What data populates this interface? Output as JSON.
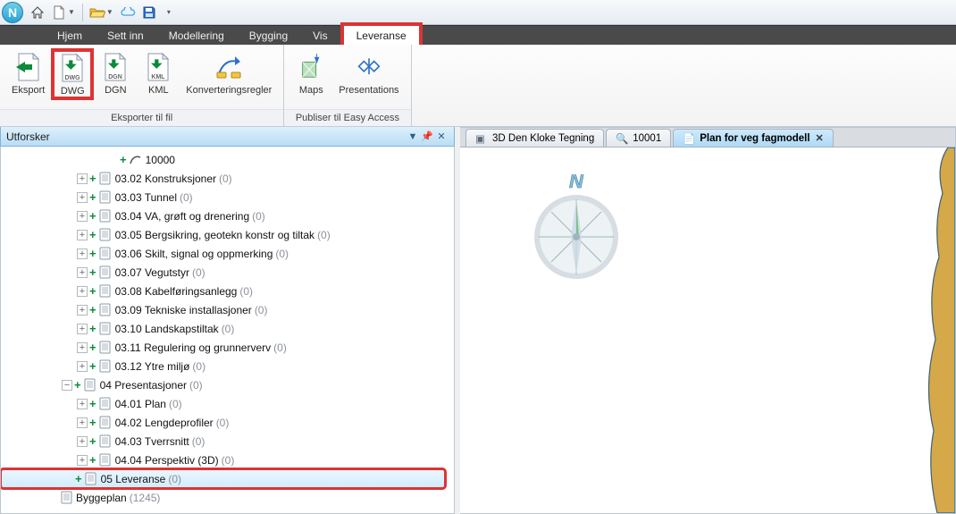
{
  "qat": {
    "app_letter": "N"
  },
  "ribbon_tabs": {
    "hjem": "Hjem",
    "settinn": "Sett inn",
    "modellering": "Modellering",
    "bygging": "Bygging",
    "vis": "Vis",
    "leveranse": "Leveranse"
  },
  "ribbon": {
    "group1_label": "Eksporter til fil",
    "group2_label": "Publiser til Easy Access",
    "btn_eksport": "Eksport",
    "btn_dwg": "DWG",
    "btn_dgn": "DGN",
    "btn_kml": "KML",
    "btn_konv": "Konverteringsregler",
    "btn_maps": "Maps",
    "btn_presentations": "Presentations"
  },
  "explorer": {
    "title": "Utforsker"
  },
  "tree": [
    {
      "indent": 7,
      "expand": "none",
      "plus": true,
      "icon": "curve",
      "label": "10000",
      "count": null
    },
    {
      "indent": 5,
      "expand": "plus",
      "plus": true,
      "icon": "doc",
      "label": "03.02 Konstruksjoner",
      "count": 0
    },
    {
      "indent": 5,
      "expand": "plus",
      "plus": true,
      "icon": "doc",
      "label": "03.03 Tunnel",
      "count": 0
    },
    {
      "indent": 5,
      "expand": "plus",
      "plus": true,
      "icon": "doc",
      "label": "03.04 VA, grøft og drenering",
      "count": 0
    },
    {
      "indent": 5,
      "expand": "plus",
      "plus": true,
      "icon": "doc",
      "label": "03.05 Bergsikring, geotekn konstr og tiltak",
      "count": 0
    },
    {
      "indent": 5,
      "expand": "plus",
      "plus": true,
      "icon": "doc",
      "label": "03.06 Skilt, signal og oppmerking",
      "count": 0
    },
    {
      "indent": 5,
      "expand": "plus",
      "plus": true,
      "icon": "doc",
      "label": "03.07 Vegutstyr",
      "count": 0
    },
    {
      "indent": 5,
      "expand": "plus",
      "plus": true,
      "icon": "doc",
      "label": "03.08 Kabelføringsanlegg",
      "count": 0
    },
    {
      "indent": 5,
      "expand": "plus",
      "plus": true,
      "icon": "doc",
      "label": "03.09 Tekniske installasjoner",
      "count": 0
    },
    {
      "indent": 5,
      "expand": "plus",
      "plus": true,
      "icon": "doc",
      "label": "03.10 Landskapstiltak",
      "count": 0
    },
    {
      "indent": 5,
      "expand": "plus",
      "plus": true,
      "icon": "doc",
      "label": "03.11 Regulering og grunnerverv",
      "count": 0
    },
    {
      "indent": 5,
      "expand": "plus",
      "plus": true,
      "icon": "doc",
      "label": "03.12 Ytre miljø",
      "count": 0
    },
    {
      "indent": 4,
      "expand": "minus",
      "plus": true,
      "icon": "doc",
      "label": "04 Presentasjoner",
      "count": 0
    },
    {
      "indent": 5,
      "expand": "plus",
      "plus": true,
      "icon": "doc",
      "label": "04.01 Plan",
      "count": 0
    },
    {
      "indent": 5,
      "expand": "plus",
      "plus": true,
      "icon": "doc",
      "label": "04.02 Lengdeprofiler",
      "count": 0
    },
    {
      "indent": 5,
      "expand": "plus",
      "plus": true,
      "icon": "doc",
      "label": "04.03 Tverrsnitt",
      "count": 0
    },
    {
      "indent": 5,
      "expand": "plus",
      "plus": true,
      "icon": "doc",
      "label": "04.04 Perspektiv (3D)",
      "count": 0
    },
    {
      "indent": 4,
      "expand": "none",
      "plus": true,
      "icon": "doc",
      "label": "05 Leveranse",
      "count": 0,
      "selected": true,
      "highlighted": true
    },
    {
      "indent": 3,
      "expand": "none",
      "plus": false,
      "icon": "doc",
      "label": "Byggeplan",
      "count": 1245
    }
  ],
  "view_tabs": {
    "t1": "3D Den Kloke Tegning",
    "t2": "10001",
    "t3": "Plan for veg fagmodell"
  },
  "compass_letter": "N"
}
